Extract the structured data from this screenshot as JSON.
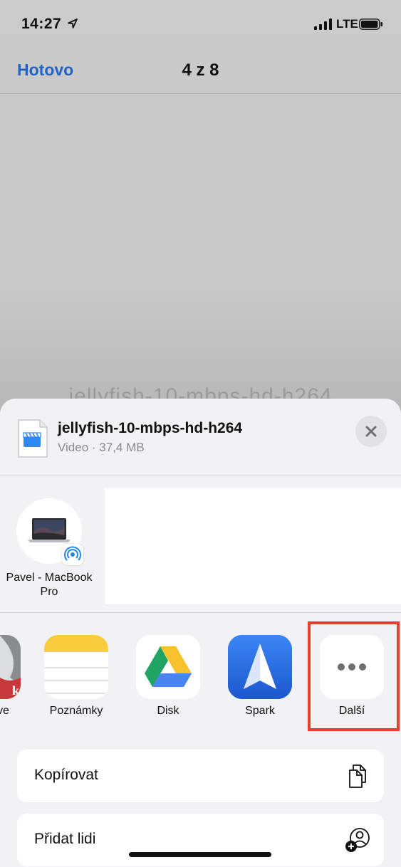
{
  "status_bar": {
    "time": "14:27",
    "network": "LTE"
  },
  "nav": {
    "done_label": "Hotovo",
    "title": "4 z 8"
  },
  "background": {
    "filename_partial": "jellyfish-10-mbps-hd-h264"
  },
  "share_sheet": {
    "file": {
      "name": "jellyfish-10-mbps-hd-h264",
      "meta": "Video · 37,4 MB"
    },
    "airdrop": {
      "device_label": "Pavel - MacBook Pro"
    },
    "apps": [
      {
        "label": "rive",
        "icon": "drive-app-icon"
      },
      {
        "label": "Poznámky",
        "icon": "notes-app-icon"
      },
      {
        "label": "Disk",
        "icon": "google-drive-app-icon"
      },
      {
        "label": "Spark",
        "icon": "spark-app-icon"
      },
      {
        "label": "Další",
        "icon": "more-icon"
      }
    ],
    "actions": [
      {
        "label": "Kopírovat",
        "icon": "copy-icon"
      },
      {
        "label": "Přidat lidi",
        "icon": "add-people-icon"
      }
    ]
  },
  "colors": {
    "accent": "#1f63c4",
    "highlight": "#e8402a",
    "sheet_bg": "#f2f2f5"
  }
}
